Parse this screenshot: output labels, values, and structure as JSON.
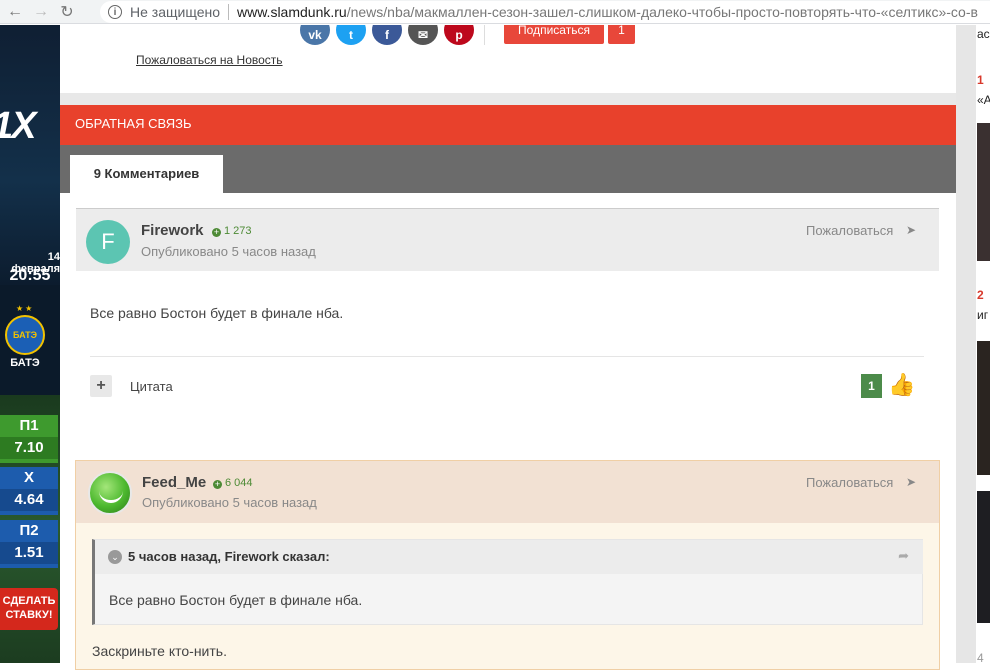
{
  "browser": {
    "insecure_label": "Не защищено",
    "url_host": "www.slamdunk.ru",
    "url_path": "/news/nba/макмаллен-сезон-зашел-слишком-далеко-чтобы-просто-повторять-что-«селтикс»-со-в"
  },
  "left_ad": {
    "logo": "1X",
    "date": "14 февраля",
    "time": "20:55",
    "crest_text": "БАТЭ",
    "team": "БАТЭ",
    "odds": [
      {
        "label": "П1",
        "value": "7.10"
      },
      {
        "label": "X",
        "value": "4.64"
      },
      {
        "label": "П2",
        "value": "1.51"
      }
    ],
    "bet_button": "СДЕЛАТЬ СТАВКУ!"
  },
  "article_footer": {
    "subscribe_label": "Подписаться",
    "subscribe_count": "1",
    "report_news": "Пожаловаться на Новость"
  },
  "feedback": {
    "title": "ОБРАТНАЯ СВЯЗЬ"
  },
  "tabs": {
    "active": "9 Комментариев"
  },
  "comments": [
    {
      "avatar_letter": "F",
      "author": "Firework",
      "reputation": "1 273",
      "posted": "Опубликовано 5 часов назад",
      "report": "Пожаловаться",
      "body": "Все равно Бостон будет в финале нба.",
      "quote_label": "Цитата",
      "likes": "1"
    },
    {
      "author": "Feed_Me",
      "reputation": "6 044",
      "posted": "Опубликовано 5 часов назад",
      "report": "Пожаловаться",
      "quote_header": "5 часов назад, Firework сказал:",
      "quote_text": "Все равно Бостон будет в финале нба.",
      "body": "Заскриньте кто-нить."
    }
  ],
  "right_sidebar": {
    "line1": "ас",
    "line2_num": "1",
    "line3": "«А",
    "line4_num": "2",
    "line5": "иг",
    "line6_num": "4"
  }
}
